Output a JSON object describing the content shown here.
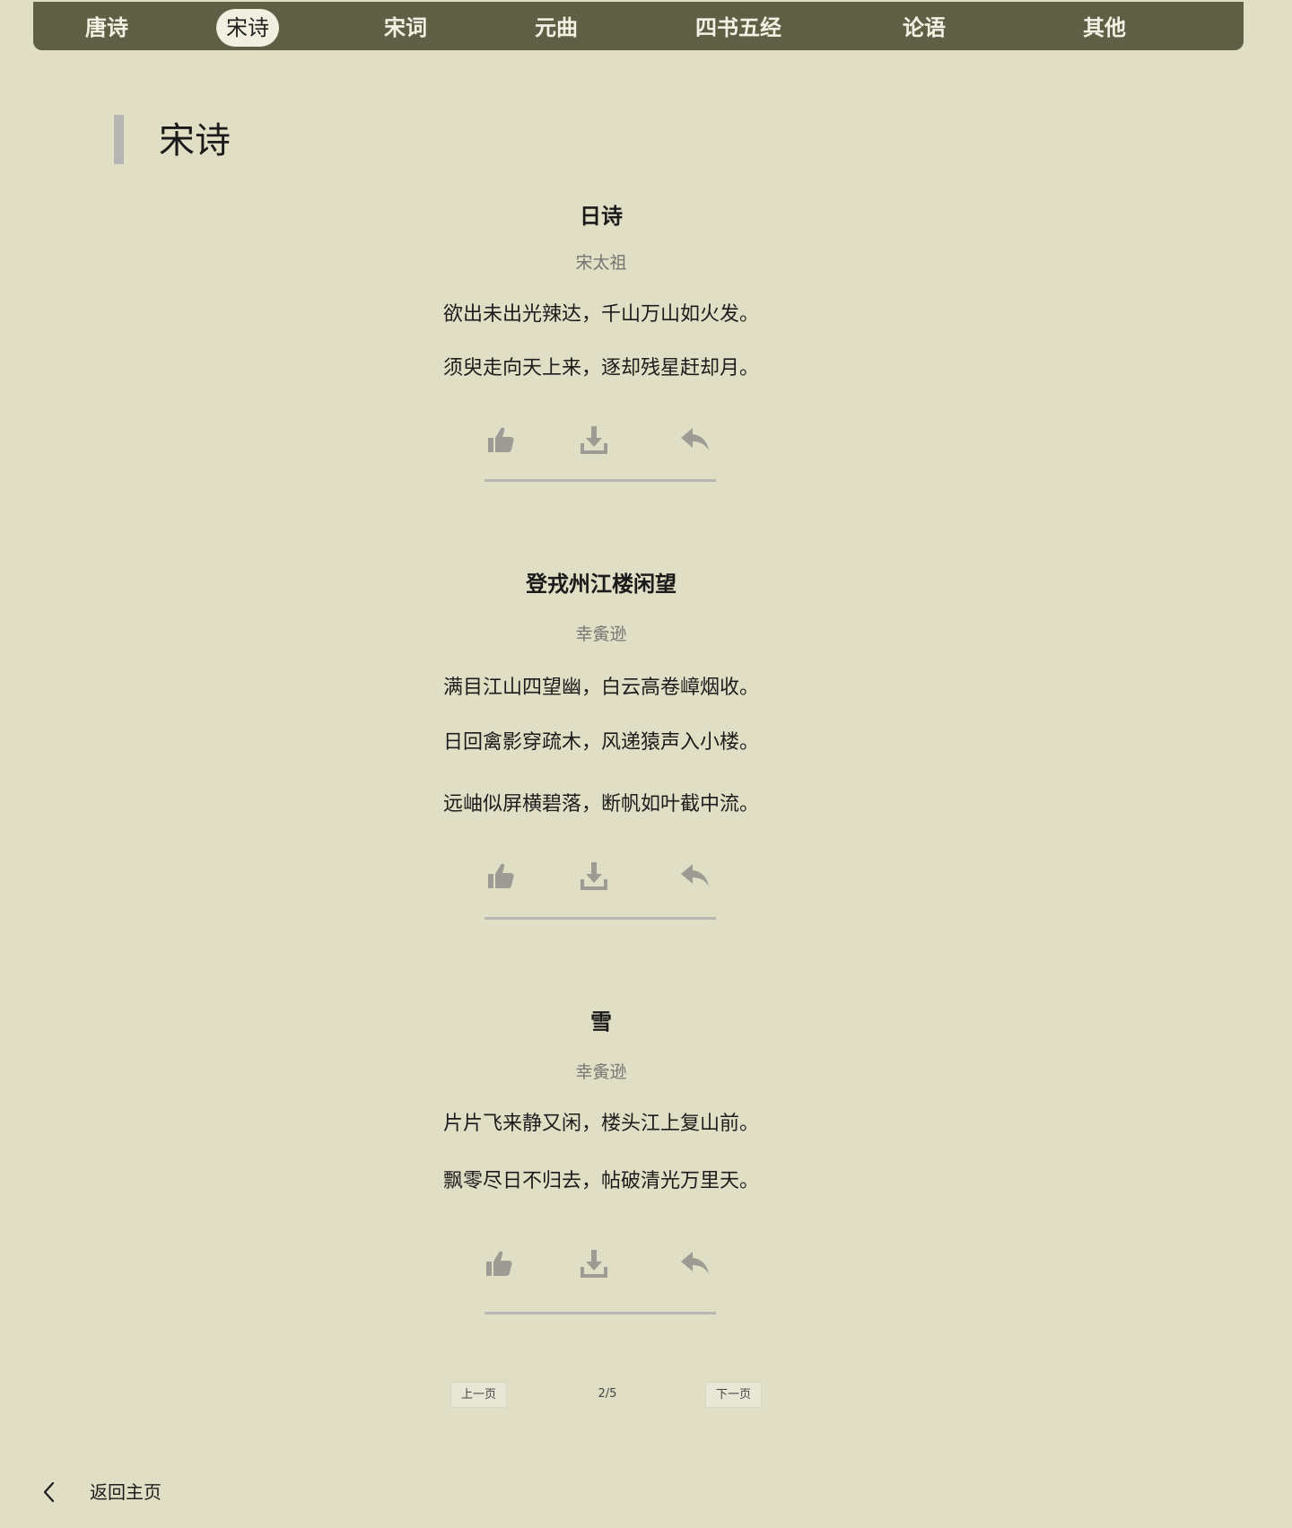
{
  "nav": {
    "items": [
      {
        "label": "唐诗",
        "active": false
      },
      {
        "label": "宋诗",
        "active": true
      },
      {
        "label": "宋词",
        "active": false
      },
      {
        "label": "元曲",
        "active": false
      },
      {
        "label": "四书五经",
        "active": false
      },
      {
        "label": "论语",
        "active": false
      },
      {
        "label": "其他",
        "active": false
      }
    ]
  },
  "section": {
    "title": "宋诗"
  },
  "poems": [
    {
      "title": "日诗",
      "author": "宋太祖",
      "lines": [
        "欲出未出光辣达，千山万山如火发。",
        "须臾走向天上来，逐却残星赶却月。"
      ]
    },
    {
      "title": "登戎州江楼闲望",
      "author": "幸夤逊",
      "lines": [
        "满目江山四望幽，白云高卷嶂烟收。",
        "日回禽影穿疏木，风递猿声入小楼。",
        "远岫似屏横碧落，断帆如叶截中流。"
      ]
    },
    {
      "title": "雪",
      "author": "幸夤逊",
      "lines": [
        "片片飞来静又闲，楼头江上复山前。",
        "飘零尽日不归去，帖破清光万里天。"
      ]
    }
  ],
  "actions": {
    "icons": [
      "thumbs-up-icon",
      "download-icon",
      "share-reply-icon"
    ],
    "color": "#9c9b94"
  },
  "pagination": {
    "prev_label": "上一页",
    "page_info": "2/5",
    "next_label": "下一页"
  },
  "footer": {
    "back_label": "返回主页",
    "icon": "chevron-left-icon"
  },
  "colors": {
    "background": "#e0dfc6",
    "nav_background": "#5e6046",
    "nav_active_pill": "#f2efe0"
  }
}
